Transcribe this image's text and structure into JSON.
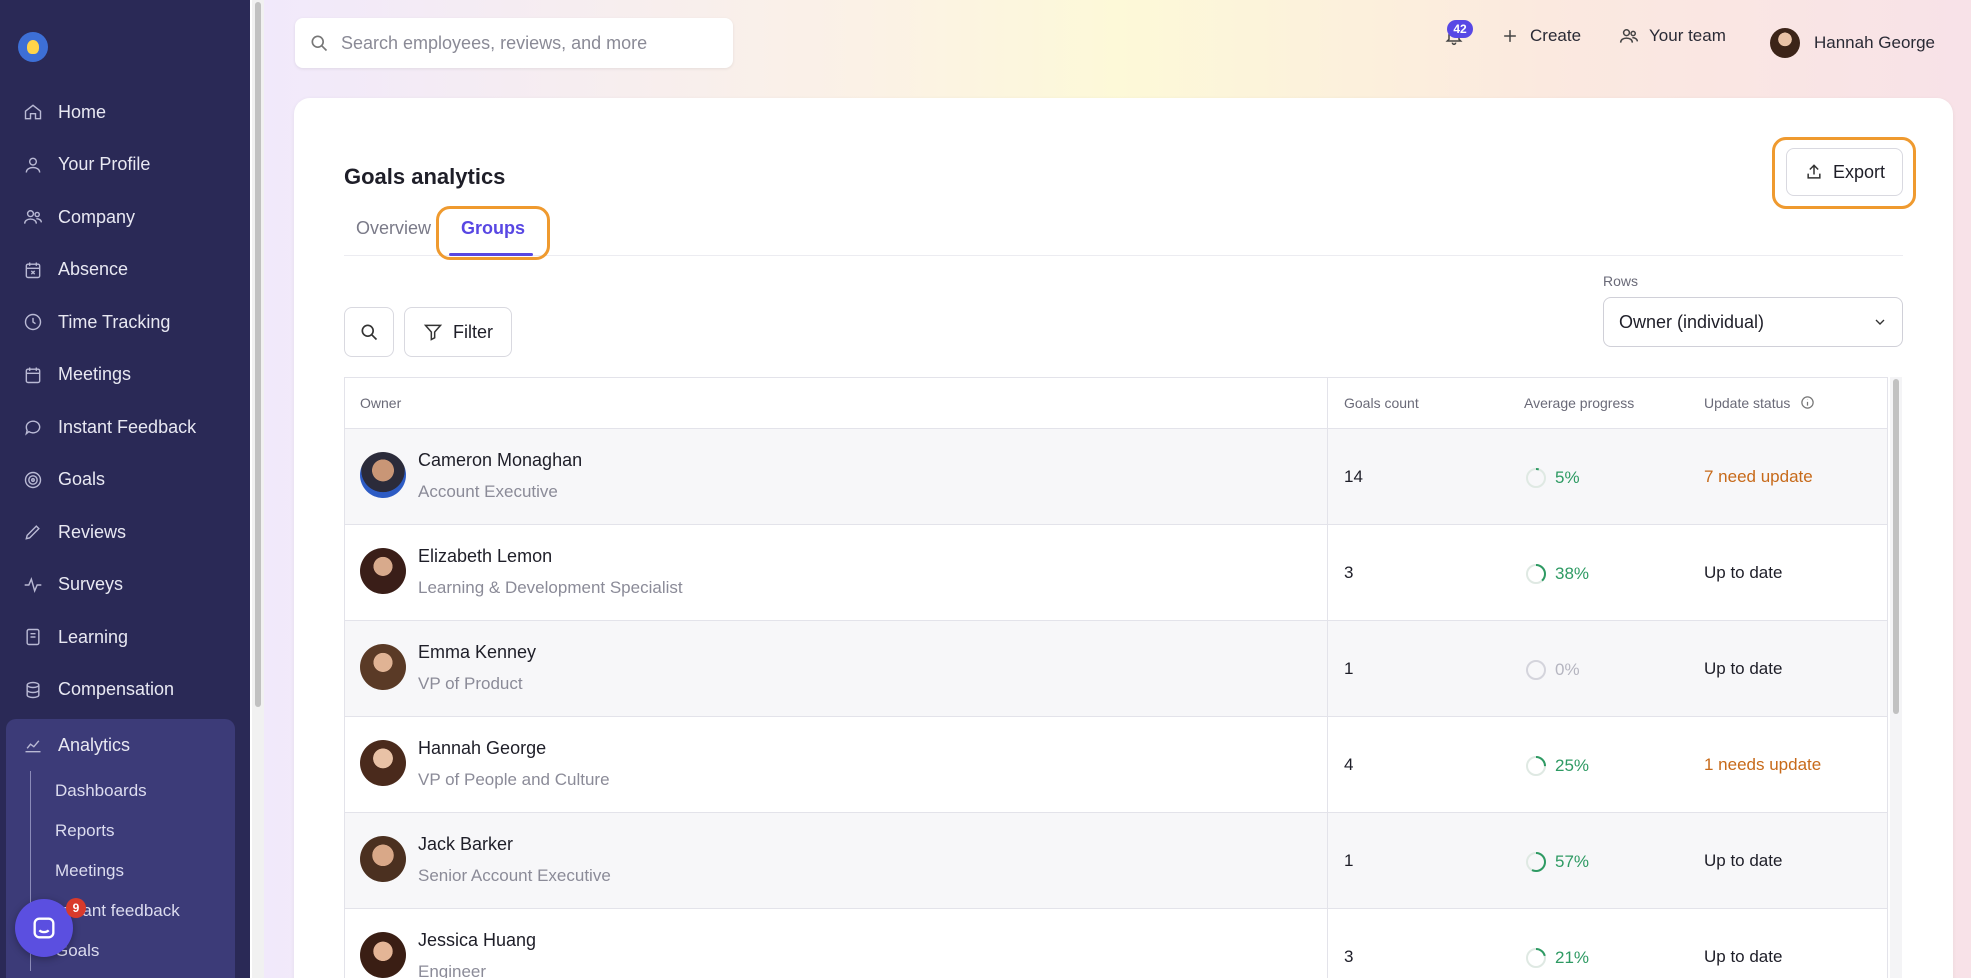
{
  "sidebar": {
    "items": [
      {
        "label": "Home",
        "icon": "home-icon"
      },
      {
        "label": "Your Profile",
        "icon": "user-icon"
      },
      {
        "label": "Company",
        "icon": "people-icon"
      },
      {
        "label": "Absence",
        "icon": "calendar-x-icon"
      },
      {
        "label": "Time Tracking",
        "icon": "clock-icon"
      },
      {
        "label": "Meetings",
        "icon": "calendar-icon"
      },
      {
        "label": "Instant Feedback",
        "icon": "chat-icon"
      },
      {
        "label": "Goals",
        "icon": "target-icon"
      },
      {
        "label": "Reviews",
        "icon": "pencil-icon"
      },
      {
        "label": "Surveys",
        "icon": "pulse-icon"
      },
      {
        "label": "Learning",
        "icon": "book-icon"
      },
      {
        "label": "Compensation",
        "icon": "coins-icon"
      }
    ],
    "analytics": {
      "label": "Analytics",
      "icon": "chart-icon",
      "sub_items": [
        "Dashboards",
        "Reports",
        "Meetings",
        "Instant feedback",
        "Goals"
      ]
    },
    "chat_badge": "9"
  },
  "header": {
    "search_placeholder": "Search employees, reviews, and more",
    "notification_count": "42",
    "create_label": "Create",
    "team_label": "Your team",
    "user_name": "Hannah George"
  },
  "page": {
    "title": "Goals analytics",
    "export_label": "Export",
    "tabs": [
      {
        "label": "Overview",
        "active": false
      },
      {
        "label": "Groups",
        "active": true
      }
    ],
    "filter_label": "Filter",
    "rows_label": "Rows",
    "rows_value": "Owner (individual)"
  },
  "table": {
    "headers": {
      "owner": "Owner",
      "goals_count": "Goals count",
      "average_progress": "Average progress",
      "update_status": "Update status"
    },
    "rows": [
      {
        "name": "Cameron Monaghan",
        "title": "Account Executive",
        "count": "14",
        "progress": "5%",
        "progress_value": 0.05,
        "status": "7 need update",
        "status_warn": true
      },
      {
        "name": "Elizabeth Lemon",
        "title": "Learning & Development Specialist",
        "count": "3",
        "progress": "38%",
        "progress_value": 0.38,
        "status": "Up to date",
        "status_warn": false
      },
      {
        "name": "Emma Kenney",
        "title": "VP of Product",
        "count": "1",
        "progress": "0%",
        "progress_value": 0,
        "status": "Up to date",
        "status_warn": false
      },
      {
        "name": "Hannah George",
        "title": "VP of People and Culture",
        "count": "4",
        "progress": "25%",
        "progress_value": 0.25,
        "status": "1 needs update",
        "status_warn": true
      },
      {
        "name": "Jack Barker",
        "title": "Senior Account Executive",
        "count": "1",
        "progress": "57%",
        "progress_value": 0.57,
        "status": "Up to date",
        "status_warn": false
      },
      {
        "name": "Jessica Huang",
        "title": "Engineer",
        "count": "3",
        "progress": "21%",
        "progress_value": 0.21,
        "status": "Up to date",
        "status_warn": false
      }
    ]
  },
  "colors": {
    "sidebar_bg": "#2a2956",
    "accent": "#5847e3",
    "highlight_ring": "#ef9a2f",
    "progress_green": "#2e9a63",
    "progress_zero": "#b5b5c0",
    "warn": "#c76a1a"
  }
}
